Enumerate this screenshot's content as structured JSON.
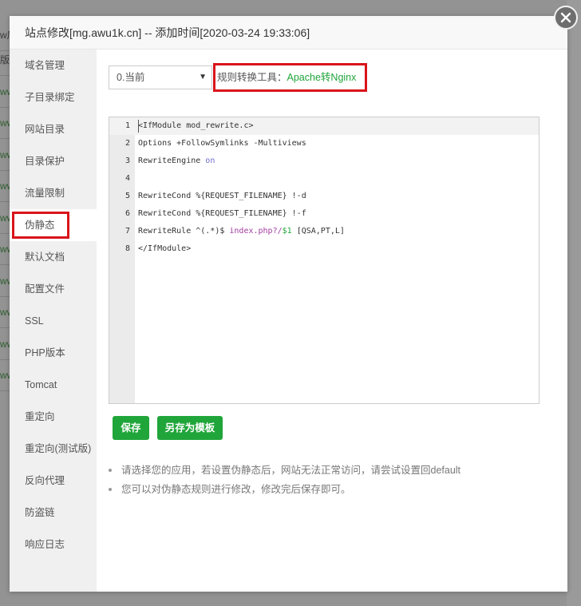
{
  "background": {
    "rows": [
      "w后",
      "版本",
      "www",
      "www",
      "www",
      "www",
      "www",
      "www",
      "www",
      "www",
      "www",
      "www"
    ]
  },
  "modal": {
    "title": "站点修改[mg.awu1k.cn] -- 添加时间[2020-03-24 19:33:06]",
    "close_icon": "close-icon"
  },
  "sidebar": {
    "active_index": 5,
    "items": [
      {
        "label": "域名管理"
      },
      {
        "label": "子目录绑定"
      },
      {
        "label": "网站目录"
      },
      {
        "label": "目录保护"
      },
      {
        "label": "流量限制"
      },
      {
        "label": "伪静态"
      },
      {
        "label": "默认文档"
      },
      {
        "label": "配置文件"
      },
      {
        "label": "SSL"
      },
      {
        "label": "PHP版本"
      },
      {
        "label": "Tomcat"
      },
      {
        "label": "重定向"
      },
      {
        "label": "重定向(测试版)"
      },
      {
        "label": "反向代理"
      },
      {
        "label": "防盗链"
      },
      {
        "label": "响应日志"
      }
    ]
  },
  "rewrite": {
    "version_select": {
      "value": "0.当前",
      "arrow": "▼"
    },
    "tool_label": "规则转换工具：",
    "tool_link": "Apache转Nginx",
    "editor": {
      "lines": [
        {
          "num": "1",
          "segments": [
            {
              "text": "<IfModule mod_rewrite.c>",
              "cls": ""
            }
          ]
        },
        {
          "num": "2",
          "segments": [
            {
              "text": "Options +FollowSymlinks -Multiviews",
              "cls": ""
            }
          ]
        },
        {
          "num": "3",
          "segments": [
            {
              "text": "RewriteEngine ",
              "cls": ""
            },
            {
              "text": "on",
              "cls": "kw-on"
            }
          ]
        },
        {
          "num": "4",
          "segments": [
            {
              "text": "",
              "cls": ""
            }
          ]
        },
        {
          "num": "5",
          "segments": [
            {
              "text": "RewriteCond %{REQUEST_FILENAME} !-d",
              "cls": ""
            }
          ]
        },
        {
          "num": "6",
          "segments": [
            {
              "text": "RewriteCond %{REQUEST_FILENAME} !-f",
              "cls": ""
            }
          ]
        },
        {
          "num": "7",
          "segments": [
            {
              "text": "RewriteRule ^(.*)$ ",
              "cls": ""
            },
            {
              "text": "index.php?/",
              "cls": "tok-purple"
            },
            {
              "text": "$1",
              "cls": "tok-green"
            },
            {
              "text": " [QSA,PT,L]",
              "cls": ""
            }
          ]
        },
        {
          "num": "8",
          "segments": [
            {
              "text": "</IfModule>",
              "cls": ""
            }
          ]
        }
      ]
    },
    "buttons": {
      "save": "保存",
      "save_as_template": "另存为模板"
    },
    "tips": [
      "请选择您的应用，若设置伪静态后，网站无法正常访问，请尝试设置回default",
      "您可以对伪静态规则进行修改，修改完后保存即可。"
    ]
  },
  "colors": {
    "accent_green": "#20a53a",
    "highlight_red": "#d9141b"
  }
}
